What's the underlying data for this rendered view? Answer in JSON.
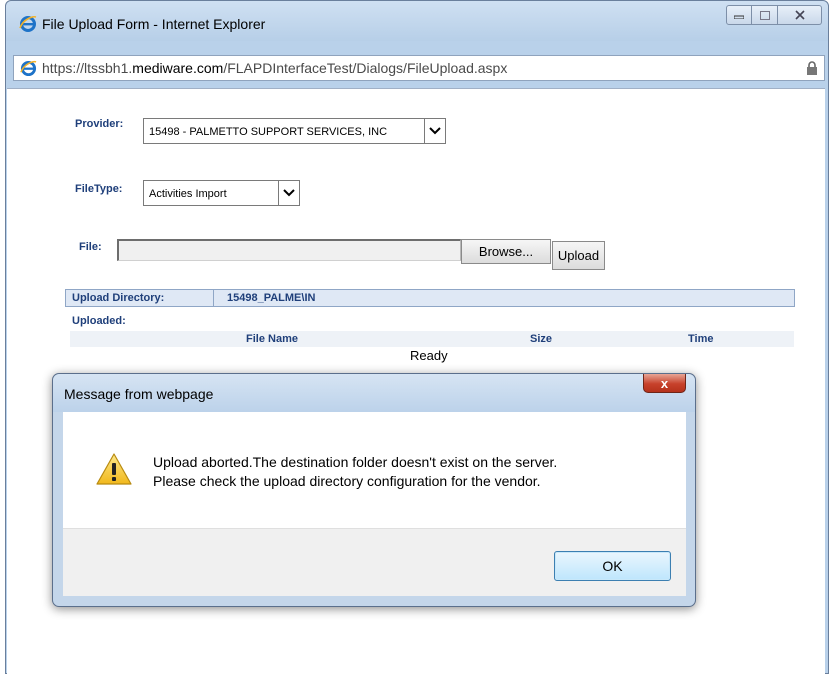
{
  "window": {
    "title": "File Upload Form - Internet Explorer",
    "url_prefix": "https://ltssbh1.",
    "url_host": "mediware.com",
    "url_path": "/FLAPDInterfaceTest/Dialogs/FileUpload.aspx"
  },
  "form": {
    "provider_label": "Provider:",
    "provider_value": "15498 - PALMETTO SUPPORT SERVICES, INC",
    "filetype_label": "FileType:",
    "filetype_value": "Activities Import",
    "file_label": "File:",
    "browse_label": "Browse...",
    "upload_label": "Upload",
    "upload_dir_label": "Upload Directory:",
    "upload_dir_value": "15498_PALME\\IN",
    "uploaded_label": "Uploaded:",
    "columns": [
      "File Name",
      "Size",
      "Time"
    ],
    "status": "Ready"
  },
  "dialog": {
    "title": "Message from webpage",
    "close_label": "x",
    "message_line1": "Upload aborted.The destination folder doesn't exist on the server.",
    "message_line2": "Please check the upload directory configuration for the vendor.",
    "ok_label": "OK"
  }
}
